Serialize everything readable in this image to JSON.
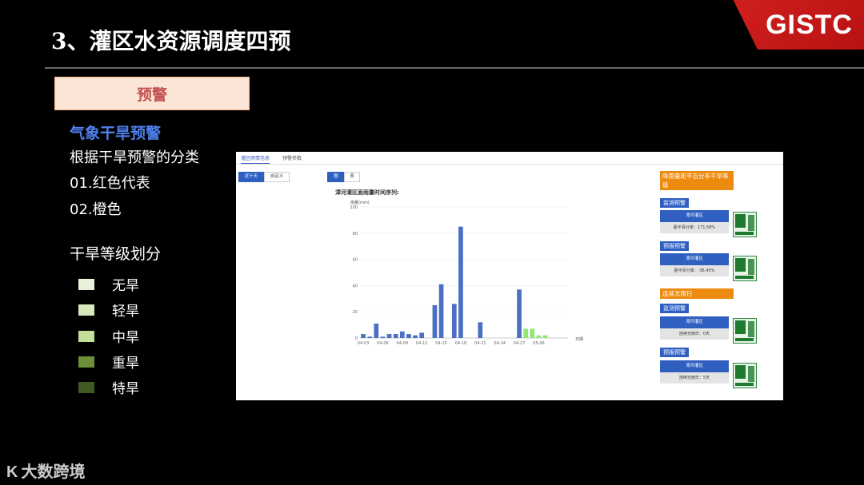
{
  "slide": {
    "title": "3、灌区水资源调度四预",
    "logo": "GISTC",
    "warn_box": "预警",
    "subhead": "气象干旱预警",
    "lines": [
      "根据干旱预警的分类",
      "01.红色代表",
      "02.橙色"
    ],
    "grade_heading": "干旱等级划分",
    "grades": [
      {
        "label": "无旱",
        "color": "#e9f1da"
      },
      {
        "label": "轻旱",
        "color": "#d8e8bd"
      },
      {
        "label": "中旱",
        "color": "#c3de98"
      },
      {
        "label": "重旱",
        "color": "#6b8f3a"
      },
      {
        "label": "特旱",
        "color": "#3f5a22"
      }
    ],
    "footer": "大数跨境"
  },
  "panel": {
    "tabs": [
      "灌区雨情信息",
      "预警参数"
    ],
    "range_buttons": [
      "近十天",
      "自定义"
    ],
    "view_buttons": [
      "图",
      "表"
    ],
    "chart_title": "漳河灌区面雨量时间序列:",
    "side": {
      "header1": "降雨量距平百分率干旱等级",
      "monitor_label": "监测预警",
      "forecast_label": "预报预警",
      "header2": "连续无雨日",
      "card_name": "漳河灌区",
      "card1_value": "距平百分率：171.58%",
      "card2_value": "距平百分率：-36.45%",
      "card3_value": "连续无雨日：0天",
      "card4_value": "连续无雨日：5天"
    }
  },
  "chart_data": {
    "type": "bar",
    "ylabel": "雨量(mm)",
    "xlabel": "日期",
    "ylim": [
      0,
      100
    ],
    "yticks": [
      0,
      20,
      40,
      60,
      80,
      100
    ],
    "xticks": [
      "04-03",
      "04-06",
      "04-09",
      "04-12",
      "04-15",
      "04-18",
      "04-21",
      "04-24",
      "04-27",
      "05-06"
    ],
    "series": [
      {
        "color": "#4a6fc4",
        "points": [
          [
            0,
            3
          ],
          [
            1,
            1
          ],
          [
            2,
            11
          ],
          [
            3,
            1
          ],
          [
            4,
            3
          ],
          [
            5,
            3
          ],
          [
            6,
            5
          ],
          [
            7,
            3
          ],
          [
            8,
            2
          ],
          [
            9,
            4
          ],
          [
            11,
            25
          ],
          [
            12,
            41
          ],
          [
            14,
            26
          ],
          [
            15,
            85
          ],
          [
            18,
            12
          ],
          [
            24,
            37
          ]
        ]
      },
      {
        "color": "#8ee872",
        "points": [
          [
            25,
            7
          ],
          [
            26,
            7
          ],
          [
            27,
            2
          ],
          [
            28,
            2
          ]
        ]
      }
    ]
  }
}
